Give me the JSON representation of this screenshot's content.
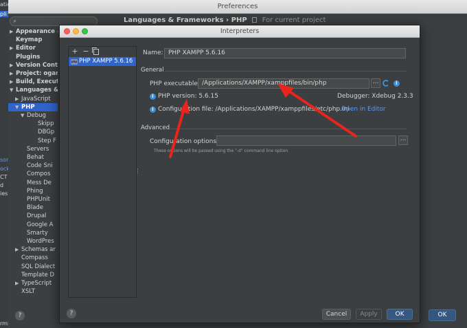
{
  "background_app": {
    "fragments": [
      {
        "text": "ation",
        "style": "normal"
      },
      {
        "text": "pli",
        "style": "sel"
      },
      {
        "text": "sor",
        "style": "blue"
      },
      {
        "text": "ock",
        "style": "blue"
      },
      {
        "text": "CT",
        "style": "normal"
      },
      {
        "text": "d",
        "style": "normal"
      },
      {
        "text": "ies",
        "style": "normal"
      },
      {
        "text": "rmi",
        "style": "normal"
      }
    ]
  },
  "preferences": {
    "title": "Preferences",
    "search_icon": "search-icon",
    "header": {
      "breadcrumb": "Languages & Frameworks › PHP",
      "scope": "For current project"
    },
    "tree": [
      {
        "label": "Appearance &",
        "arrow": "▶",
        "bold": true,
        "indent": 0
      },
      {
        "label": "Keymap",
        "arrow": "",
        "bold": true,
        "indent": 0
      },
      {
        "label": "Editor",
        "arrow": "▶",
        "bold": true,
        "indent": 0
      },
      {
        "label": "Plugins",
        "arrow": "",
        "bold": true,
        "indent": 0
      },
      {
        "label": "Version Contr",
        "arrow": "▶",
        "bold": true,
        "indent": 0
      },
      {
        "label": "Project: ogara",
        "arrow": "▶",
        "bold": true,
        "indent": 0
      },
      {
        "label": "Build, Executio",
        "arrow": "▶",
        "bold": true,
        "indent": 0
      },
      {
        "label": "Languages &",
        "arrow": "▼",
        "bold": true,
        "indent": 0
      },
      {
        "label": "JavaScript",
        "arrow": "▶",
        "bold": false,
        "indent": 1
      },
      {
        "label": "PHP",
        "arrow": "▼",
        "bold": true,
        "indent": 1,
        "selected": true
      },
      {
        "label": "Debug",
        "arrow": "▼",
        "bold": false,
        "indent": 2
      },
      {
        "label": "Skipp",
        "arrow": "",
        "bold": false,
        "indent": 4
      },
      {
        "label": "DBGp",
        "arrow": "",
        "bold": false,
        "indent": 4
      },
      {
        "label": "Step F",
        "arrow": "",
        "bold": false,
        "indent": 4
      },
      {
        "label": "Servers",
        "arrow": "",
        "bold": false,
        "indent": 2
      },
      {
        "label": "Behat",
        "arrow": "",
        "bold": false,
        "indent": 2
      },
      {
        "label": "Code Sni",
        "arrow": "",
        "bold": false,
        "indent": 2
      },
      {
        "label": "Compos",
        "arrow": "",
        "bold": false,
        "indent": 2
      },
      {
        "label": "Mess De",
        "arrow": "",
        "bold": false,
        "indent": 2
      },
      {
        "label": "Phing",
        "arrow": "",
        "bold": false,
        "indent": 2
      },
      {
        "label": "PHPUnit",
        "arrow": "",
        "bold": false,
        "indent": 2
      },
      {
        "label": "Blade",
        "arrow": "",
        "bold": false,
        "indent": 2
      },
      {
        "label": "Drupal",
        "arrow": "",
        "bold": false,
        "indent": 2
      },
      {
        "label": "Google A",
        "arrow": "",
        "bold": false,
        "indent": 2
      },
      {
        "label": "Smarty",
        "arrow": "",
        "bold": false,
        "indent": 2
      },
      {
        "label": "WordPres",
        "arrow": "",
        "bold": false,
        "indent": 2
      },
      {
        "label": "Schemas ar",
        "arrow": "▶",
        "bold": false,
        "indent": 1
      },
      {
        "label": "Compass",
        "arrow": "",
        "bold": false,
        "indent": 1
      },
      {
        "label": "SQL Dialect",
        "arrow": "",
        "bold": false,
        "indent": 1
      },
      {
        "label": "Template D",
        "arrow": "",
        "bold": false,
        "indent": 1
      },
      {
        "label": "TypeScript",
        "arrow": "▶",
        "bold": false,
        "indent": 1
      },
      {
        "label": "XSLT",
        "arrow": "",
        "bold": false,
        "indent": 1
      }
    ],
    "help_label": "?",
    "ok_label": "OK"
  },
  "interpreters": {
    "title": "Interpreters",
    "toolbar": {
      "add": "+",
      "remove": "−"
    },
    "list": [
      {
        "label": "PHP XAMPP 5.6.16",
        "icon": "php-icon"
      }
    ],
    "name_label": "Name:",
    "name_value": "PHP XAMPP 5.6.16",
    "general": {
      "title": "General",
      "executable_label": "PHP executable:",
      "executable_value": "/Applications/XAMPP/xamppfiles/bin/php",
      "browse_label": "...",
      "php_version": "PHP version: 5.6.15",
      "debugger": "Debugger: Xdebug 2.3.3",
      "config_file": "Configuration file: /Applications/XAMPP/xamppfiles/etc/php.ini",
      "open_in_editor": "Open in Editor"
    },
    "advanced": {
      "title": "Advanced",
      "config_options_label": "Configuration options:",
      "config_options_value": "",
      "browse_label": "...",
      "hint": "These options will be passed using the \"-d\" command line option"
    },
    "buttons": {
      "help": "?",
      "cancel": "Cancel",
      "apply": "Apply",
      "ok": "OK"
    }
  },
  "colors": {
    "accent": "#2f65ca",
    "link": "#589df6",
    "arrow": "#e8241d",
    "info": "#3d8fd6"
  }
}
